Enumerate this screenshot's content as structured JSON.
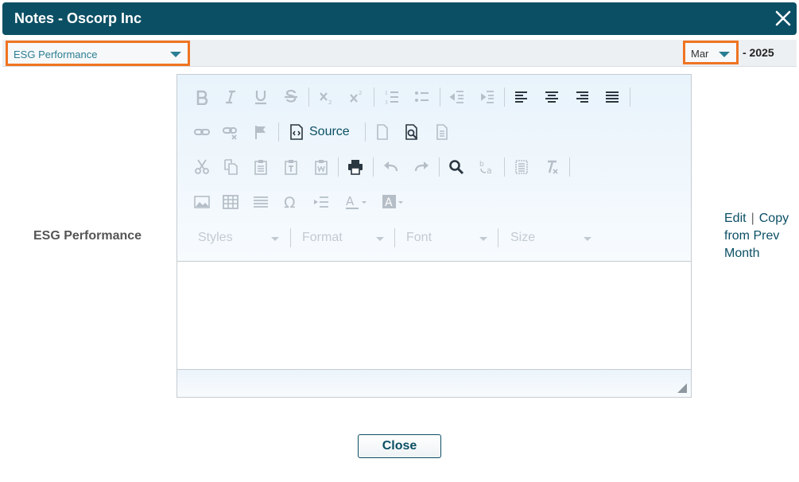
{
  "dialog": {
    "title": "Notes - Oscorp Inc"
  },
  "filters": {
    "category": "ESG Performance",
    "month": "Mar",
    "year_label": "- 2025"
  },
  "row": {
    "label": "ESG Performance"
  },
  "editor": {
    "source_label": "Source",
    "styles_placeholder": "Styles",
    "format_placeholder": "Format",
    "font_placeholder": "Font",
    "size_placeholder": "Size",
    "content": ""
  },
  "links": {
    "edit": "Edit",
    "separator": "|",
    "copy": "Copy from Prev Month"
  },
  "footer": {
    "close_label": "Close"
  }
}
